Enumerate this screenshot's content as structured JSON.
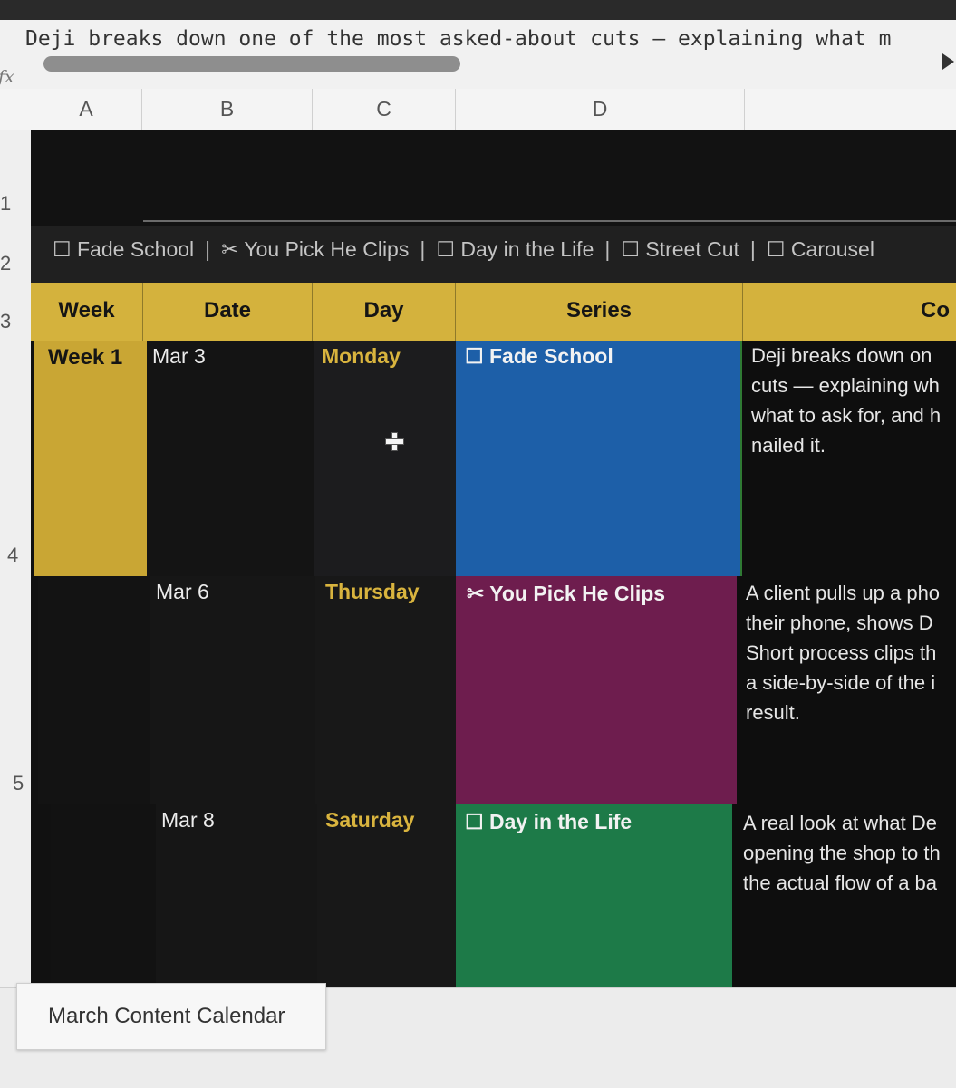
{
  "formula_bar": {
    "fx_label": "fx",
    "text": "Deji breaks down one of the most asked-about cuts — explaining what m"
  },
  "columns": [
    "A",
    "B",
    "C",
    "D"
  ],
  "rows": [
    "1",
    "2",
    "3",
    "4",
    "5"
  ],
  "legend": {
    "items": [
      "☐ Fade School",
      "✂ You Pick He Clips",
      "☐ Day in the Life",
      "☐ Street Cut",
      "☐ Carousel"
    ],
    "separator": "|"
  },
  "table": {
    "headers": [
      "Week",
      "Date",
      "Day",
      "Series",
      "Co"
    ],
    "rows": [
      {
        "week": "Week 1",
        "date": "Mar 3",
        "day": "Monday",
        "series": "☐ Fade School",
        "series_color": "#1d5fa8",
        "description_lines": [
          "Deji breaks down on",
          "cuts — explaining wh",
          "what to ask for, and h",
          "nailed it."
        ]
      },
      {
        "week": "",
        "date": "Mar 6",
        "day": "Thursday",
        "series": "✂ You Pick He Clips",
        "series_color": "#6e1d4e",
        "description_lines": [
          "A client pulls up a pho",
          "their phone, shows D",
          "Short process clips th",
          "a side-by-side of the i",
          "result."
        ]
      },
      {
        "week": "",
        "date": "Mar 8",
        "day": "Saturday",
        "series": "☐ Day in the Life",
        "series_color": "#1d7a48",
        "description_lines": [
          "A real look at what De",
          "opening the shop to th",
          "the actual flow of a ba"
        ]
      }
    ]
  },
  "colors": {
    "header_gold": "#d4b23d",
    "day_gold": "#d9b43e",
    "sheet_black": "#111111"
  },
  "sheet_tab": {
    "label": "March Content Calendar"
  }
}
